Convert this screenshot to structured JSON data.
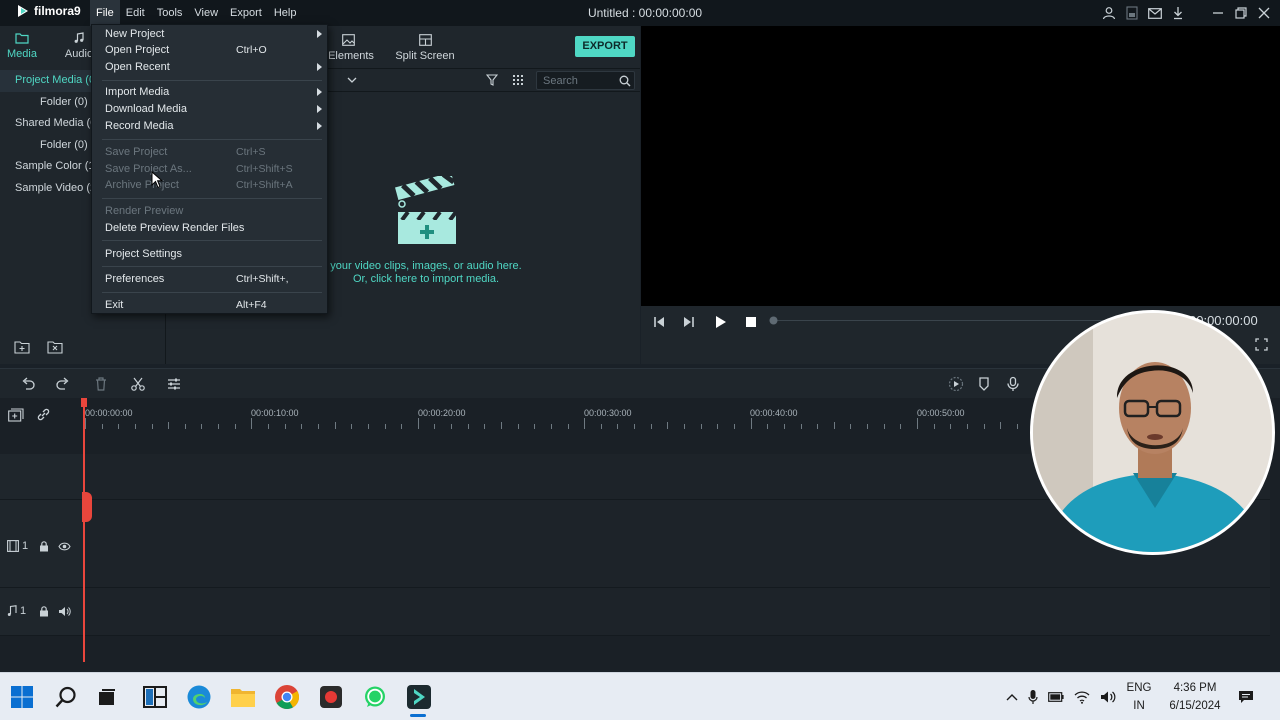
{
  "app": {
    "logo_text": "filmora9",
    "window_title": "Untitled : 00:00:00:00"
  },
  "menubar": {
    "items": [
      "File",
      "Edit",
      "Tools",
      "View",
      "Export",
      "Help"
    ]
  },
  "left_panel": {
    "tabs": [
      {
        "label": "Media",
        "icon": "folder-icon"
      },
      {
        "label": "Audio",
        "icon": "music-note-icon"
      }
    ],
    "tree": [
      {
        "label": "Project Media (0)",
        "level": 1
      },
      {
        "label": "Folder (0)",
        "level": 2
      },
      {
        "label": "Shared Media (0)",
        "level": 1
      },
      {
        "label": "Folder (0)",
        "level": 2
      },
      {
        "label": "Sample Color (15)",
        "level": 1
      },
      {
        "label": "Sample Video (20)",
        "level": 1
      }
    ]
  },
  "library": {
    "tabs": [
      {
        "label": "Elements",
        "icon": "image-icon"
      },
      {
        "label": "Split Screen",
        "icon": "split-screen-icon"
      }
    ],
    "export_label": "EXPORT",
    "toolbar_label": "d",
    "search_placeholder": "Search",
    "import_line1": "your video clips, images, or audio here.",
    "import_line2": "Or, click here to import media."
  },
  "file_menu": {
    "items": [
      {
        "label": "New Project",
        "shortcut": "",
        "submenu": true,
        "disabled": false
      },
      {
        "label": "Open Project",
        "shortcut": "Ctrl+O",
        "submenu": false,
        "disabled": false
      },
      {
        "label": "Open Recent",
        "shortcut": "",
        "submenu": true,
        "disabled": false
      },
      {
        "label": "Import Media",
        "shortcut": "",
        "submenu": true,
        "disabled": false
      },
      {
        "label": "Download Media",
        "shortcut": "",
        "submenu": true,
        "disabled": false
      },
      {
        "label": "Record Media",
        "shortcut": "",
        "submenu": true,
        "disabled": false
      },
      {
        "label": "Save Project",
        "shortcut": "Ctrl+S",
        "submenu": false,
        "disabled": true
      },
      {
        "label": "Save Project As...",
        "shortcut": "Ctrl+Shift+S",
        "submenu": false,
        "disabled": true
      },
      {
        "label": "Archive Project",
        "shortcut": "Ctrl+Shift+A",
        "submenu": false,
        "disabled": true
      },
      {
        "label": "Render Preview",
        "shortcut": "",
        "submenu": false,
        "disabled": true
      },
      {
        "label": "Delete Preview Render Files",
        "shortcut": "",
        "submenu": false,
        "disabled": false
      },
      {
        "label": "Project Settings",
        "shortcut": "",
        "submenu": false,
        "disabled": false
      },
      {
        "label": "Preferences",
        "shortcut": "Ctrl+Shift+,",
        "submenu": false,
        "disabled": false
      },
      {
        "label": "Exit",
        "shortcut": "Alt+F4",
        "submenu": false,
        "disabled": false
      }
    ]
  },
  "preview": {
    "timecode": "00:00:00:00"
  },
  "timeline": {
    "ruler_labels": [
      "00:00:00:00",
      "00:00:10:00",
      "00:00:20:00",
      "00:00:30:00",
      "00:00:40:00",
      "00:00:50:00"
    ],
    "video_track_number": "1",
    "audio_track_number": "1"
  },
  "taskbar": {
    "language_line1": "ENG",
    "language_line2": "IN",
    "time": "4:36 PM",
    "date": "6/15/2024"
  },
  "colors": {
    "accent": "#4fd7c4",
    "playhead": "#e9463c",
    "panel": "#1f262c",
    "titlebar": "#11171c"
  }
}
